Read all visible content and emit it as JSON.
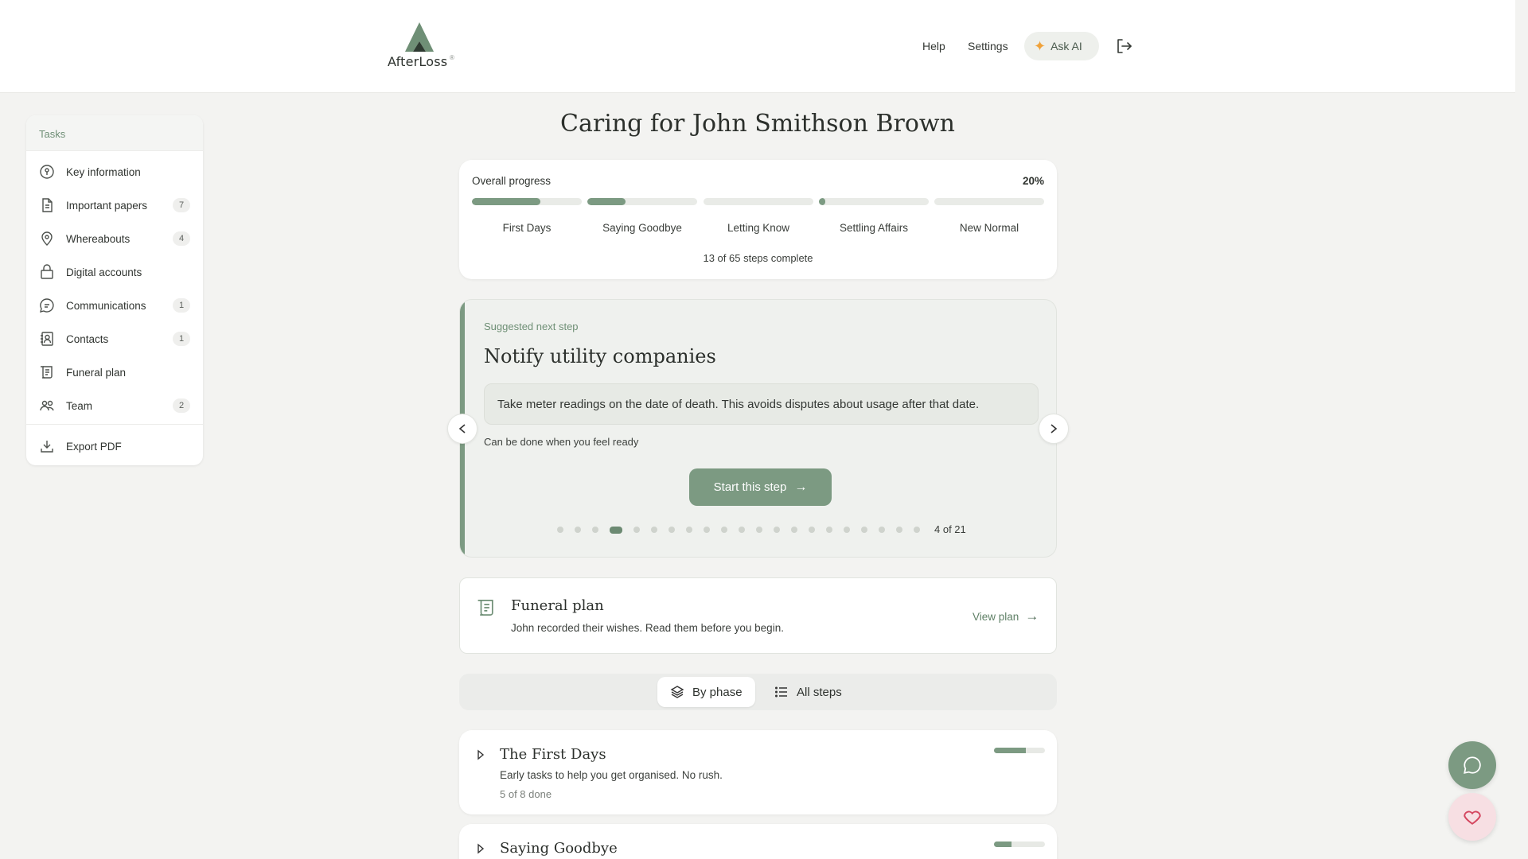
{
  "header": {
    "logo_text": "AfterLoss",
    "logo_reg": "®",
    "nav": {
      "help": "Help",
      "settings": "Settings",
      "ask_ai": "Ask AI"
    }
  },
  "sidebar": {
    "heading": "Tasks",
    "items": [
      {
        "label": "Key information",
        "count": "",
        "icon": "key-info-icon"
      },
      {
        "label": "Important papers",
        "count": "7",
        "icon": "document-icon"
      },
      {
        "label": "Whereabouts",
        "count": "4",
        "icon": "map-pin-icon"
      },
      {
        "label": "Digital accounts",
        "count": "",
        "icon": "lock-icon"
      },
      {
        "label": "Communications",
        "count": "1",
        "icon": "chat-icon"
      },
      {
        "label": "Contacts",
        "count": "1",
        "icon": "contact-book-icon"
      },
      {
        "label": "Funeral plan",
        "count": "",
        "icon": "scroll-icon"
      },
      {
        "label": "Team",
        "count": "2",
        "icon": "team-icon"
      }
    ],
    "export": "Export PDF"
  },
  "main": {
    "title": "Caring for John Smithson Brown",
    "progress": {
      "label": "Overall progress",
      "percent_text": "20%",
      "phases": [
        {
          "name": "First Days",
          "fraction": 0.62
        },
        {
          "name": "Saying Goodbye",
          "fraction": 0.35
        },
        {
          "name": "Letting Know",
          "fraction": 0.0
        },
        {
          "name": "Settling Affairs",
          "fraction": 0.06
        },
        {
          "name": "New Normal",
          "fraction": 0.0
        }
      ],
      "steps_text": "13 of 65 steps complete"
    },
    "next_step": {
      "kicker": "Suggested next step",
      "title": "Notify utility companies",
      "tip": "Take meter readings on the date of death. This avoids disputes about usage after that date.",
      "when": "Can be done when you feel ready",
      "button": "Start this step",
      "current": 4,
      "total": 21,
      "counter": "4 of 21"
    },
    "funeral_card": {
      "title": "Funeral plan",
      "subtitle": "John recorded their wishes. Read them before you begin.",
      "link": "View plan"
    },
    "view_toggle": {
      "by_phase": "By phase",
      "all_steps": "All steps"
    },
    "phase_cards": [
      {
        "title": "The First Days",
        "desc": "Early tasks to help you get organised. No rush.",
        "done": "5 of 8 done",
        "fraction": 0.62
      },
      {
        "title": "Saying Goodbye",
        "desc": "",
        "done": "",
        "fraction": 0.35
      }
    ]
  },
  "colors": {
    "accent": "#7c9a82",
    "background": "#f3f3f1",
    "ask_ai_spark": "#f0a23a",
    "heart": "#d4465f"
  }
}
